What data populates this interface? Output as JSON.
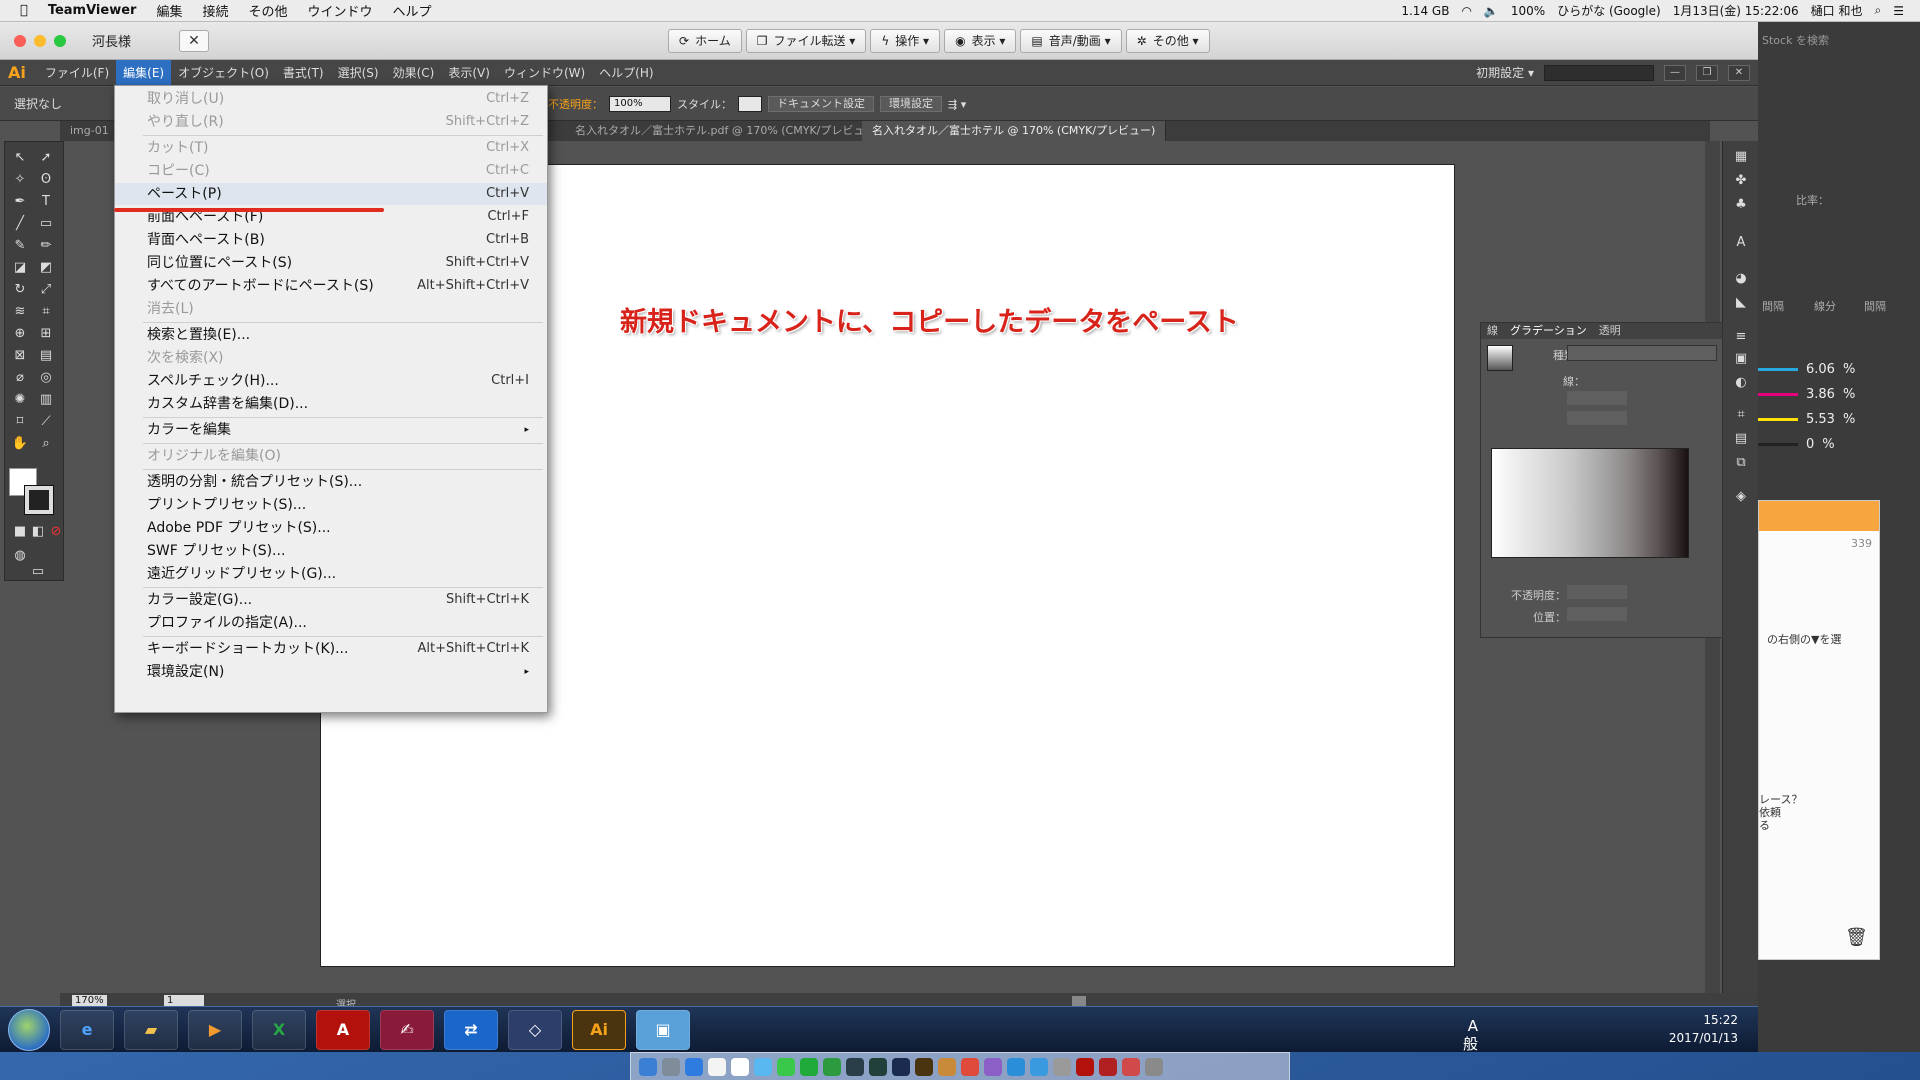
{
  "mac_menubar": {
    "app": "TeamViewer",
    "items": [
      "編集",
      "接続",
      "その他",
      "ウインドウ",
      "ヘルプ"
    ],
    "memory": "1.14 GB",
    "battery": "100%",
    "input": "ひらがな (Google)",
    "datetime": "1月13日(金) 15:22:06",
    "user": "樋口 和也"
  },
  "teamviewer": {
    "title": "河長様",
    "close_label": "✕",
    "buttons": [
      "ホーム",
      "ファイル転送 ▾",
      "操作 ▾",
      "表示 ▾",
      "音声/動画 ▾",
      "その他 ▾"
    ]
  },
  "illustrator": {
    "logo": "Ai",
    "menu": [
      "ファイル(F)",
      "編集(E)",
      "オブジェクト(O)",
      "書式(T)",
      "選択(S)",
      "効果(C)",
      "表示(V)",
      "ウィンドウ(W)",
      "ヘルプ(H)"
    ],
    "workspace": "初期設定 ▾",
    "control": {
      "selection": "選択なし",
      "opacity_label": "不透明度：",
      "opacity": "100%",
      "style_label": "スタイル：",
      "doc_setup": "ドキュメント設定",
      "prefs": "環境設定"
    },
    "tabs": [
      "名入れタオル／富士ホテル.pdf @ 170% (CMYK/プレビュー)",
      "名入れタオル／富士ホテル @ 170% (CMYK/プレビュー)"
    ],
    "tab_left": "img-01",
    "zoom": "170%",
    "page": "1",
    "status": "選択"
  },
  "edit_menu": [
    {
      "label": "取り消し(U)",
      "key": "Ctrl+Z",
      "disabled": true
    },
    {
      "label": "やり直し(R)",
      "key": "Shift+Ctrl+Z",
      "disabled": true
    },
    {
      "sep": true
    },
    {
      "label": "カット(T)",
      "key": "Ctrl+X",
      "disabled": true
    },
    {
      "label": "コピー(C)",
      "key": "Ctrl+C",
      "disabled": true
    },
    {
      "label": "ペースト(P)",
      "key": "Ctrl+V",
      "highlight": true
    },
    {
      "label": "前面へペースト(F)",
      "key": "Ctrl+F"
    },
    {
      "label": "背面へペースト(B)",
      "key": "Ctrl+B"
    },
    {
      "label": "同じ位置にペースト(S)",
      "key": "Shift+Ctrl+V"
    },
    {
      "label": "すべてのアートボードにペースト(S)",
      "key": "Alt+Shift+Ctrl+V"
    },
    {
      "label": "消去(L)",
      "key": "",
      "disabled": true
    },
    {
      "sep": true
    },
    {
      "label": "検索と置換(E)...",
      "key": ""
    },
    {
      "label": "次を検索(X)",
      "key": "",
      "disabled": true
    },
    {
      "label": "スペルチェック(H)...",
      "key": "Ctrl+I"
    },
    {
      "label": "カスタム辞書を編集(D)...",
      "key": ""
    },
    {
      "sep": true
    },
    {
      "label": "カラーを編集",
      "key": "",
      "submenu": true
    },
    {
      "sep": true
    },
    {
      "label": "オリジナルを編集(O)",
      "key": "",
      "disabled": true
    },
    {
      "sep": true
    },
    {
      "label": "透明の分割・統合プリセット(S)...",
      "key": ""
    },
    {
      "label": "プリントプリセット(S)...",
      "key": ""
    },
    {
      "label": "Adobe PDF プリセット(S)...",
      "key": ""
    },
    {
      "label": "SWF プリセット(S)...",
      "key": ""
    },
    {
      "label": "遠近グリッドプリセット(G)...",
      "key": ""
    },
    {
      "sep": true
    },
    {
      "label": "カラー設定(G)...",
      "key": "Shift+Ctrl+K"
    },
    {
      "label": "プロファイルの指定(A)...",
      "key": ""
    },
    {
      "sep": true
    },
    {
      "label": "キーボードショートカット(K)...",
      "key": "Alt+Shift+Ctrl+K"
    },
    {
      "label": "環境設定(N)",
      "key": "",
      "submenu": true
    }
  ],
  "annotation": "新規ドキュメントに、コピーしたデータをペースト",
  "gradient_panel": {
    "tabs": [
      "線",
      "グラデーション",
      "透明"
    ],
    "type_label": "種類：",
    "stroke_label": "線：",
    "opacity_label": "不透明度：",
    "position_label": "位置："
  },
  "color_panel": {
    "values": [
      "6.06",
      "3.86",
      "5.53",
      "0"
    ],
    "unit": "%",
    "colors": [
      "#25a9e0",
      "#e6007e",
      "#ffe100",
      "#222222"
    ]
  },
  "right_panel": {
    "search": "Stock を検索",
    "ratio": "比率：",
    "labels": [
      "間隔",
      "線分",
      "間隔"
    ],
    "count": "339",
    "texts": [
      "の右側の▼を選",
      "レース？",
      "依頼",
      "る"
    ]
  },
  "taskbar": {
    "time": "15:22",
    "date": "2017/01/13",
    "ime": "A 般",
    "apps": [
      "IE",
      "Explorer",
      "Media",
      "Excel",
      "Acrobat",
      "Sign",
      "TeamViewer",
      "VirtualBox",
      "Ai",
      "Remote"
    ]
  }
}
